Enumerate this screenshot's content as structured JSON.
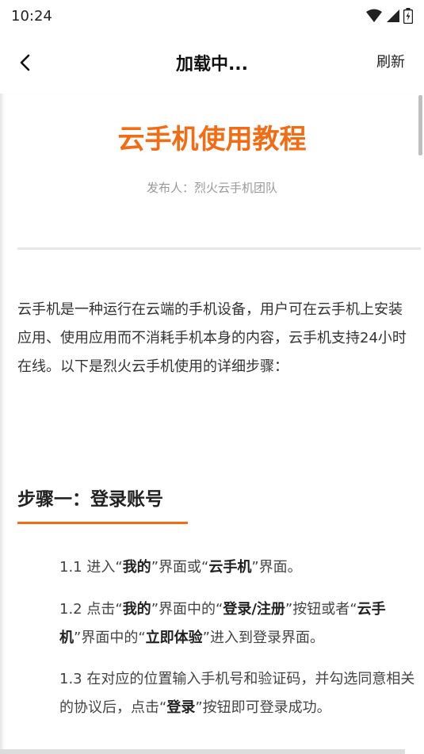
{
  "status_bar": {
    "time": "10:24"
  },
  "nav": {
    "title": "加载中...",
    "refresh_label": "刷新"
  },
  "article": {
    "title": "云手机使用教程",
    "publisher": "发布人：烈火云手机团队",
    "intro": "云手机是一种运行在云端的手机设备，用户可在云手机上安装应用、使用应用而不消耗手机本身的内容，云手机支持24小时在线。以下是烈火云手机使用的详细步骤：",
    "section_title": "步骤一：登录账号",
    "steps": [
      {
        "p1": "1.1 进入“",
        "b1": "我的",
        "p2": "”界面或“",
        "b2": "云手机",
        "p3": "”界面。"
      },
      {
        "p1": "1.2 点击“",
        "b1": "我的",
        "p2": "”界面中的“",
        "b2": "登录/注册",
        "p3": "”按钮或者“",
        "b3": "云手机",
        "p4": "”界面中的“",
        "b4": "立即体验",
        "p5": "”进入到登录界面。"
      },
      {
        "p1": "1.3 在对应的位置输入手机号和验证码，并勾选同意相关的协议后，点击“",
        "b1": "登录",
        "p2": "”按钮即可登录成功。"
      }
    ]
  },
  "colors": {
    "accent": "#f36b12"
  }
}
